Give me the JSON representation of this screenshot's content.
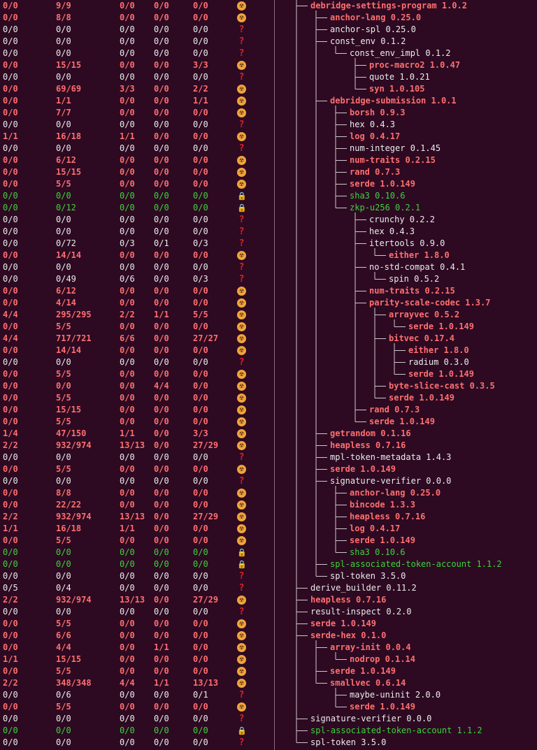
{
  "colors": {
    "background": "#2d0a22",
    "unsafe_red": "#ff6f6f",
    "safe_white": "#ececec",
    "forbid_unsafe_green": "#3bd53b",
    "radioactive_icon": "#f0a53c",
    "unknown_icon": "#e0202a",
    "lock_icon": "#bdbdbd"
  },
  "icons": {
    "radioactive": "radioactive-icon",
    "question": "question-mark-icon",
    "lock": "lock-icon"
  },
  "rows": [
    {
      "cols": [
        "0/0",
        "9/9",
        "0/0",
        "0/0",
        "0/0"
      ],
      "icon": "rad",
      "color": "red",
      "depth": 1,
      "text": "debridge-settings-program 1.0.2"
    },
    {
      "cols": [
        "0/0",
        "8/8",
        "0/0",
        "0/0",
        "0/0"
      ],
      "icon": "rad",
      "color": "red",
      "depth": 2,
      "text": "anchor-lang 0.25.0"
    },
    {
      "cols": [
        "0/0",
        "0/0",
        "0/0",
        "0/0",
        "0/0"
      ],
      "icon": "q",
      "color": "white",
      "depth": 2,
      "text": "anchor-spl 0.25.0"
    },
    {
      "cols": [
        "0/0",
        "0/0",
        "0/0",
        "0/0",
        "0/0"
      ],
      "icon": "q",
      "color": "white",
      "depth": 2,
      "text": "const_env 0.1.2"
    },
    {
      "cols": [
        "0/0",
        "0/0",
        "0/0",
        "0/0",
        "0/0"
      ],
      "icon": "q",
      "color": "white",
      "depth": 3,
      "text": "const_env_impl 0.1.2"
    },
    {
      "cols": [
        "0/0",
        "15/15",
        "0/0",
        "0/0",
        "3/3"
      ],
      "icon": "rad",
      "color": "red",
      "depth": 4,
      "text": "proc-macro2 1.0.47"
    },
    {
      "cols": [
        "0/0",
        "0/0",
        "0/0",
        "0/0",
        "0/0"
      ],
      "icon": "q",
      "color": "white",
      "depth": 4,
      "text": "quote 1.0.21"
    },
    {
      "cols": [
        "0/0",
        "69/69",
        "3/3",
        "0/0",
        "2/2"
      ],
      "icon": "rad",
      "color": "red",
      "depth": 4,
      "text": "syn 1.0.105"
    },
    {
      "cols": [
        "0/0",
        "1/1",
        "0/0",
        "0/0",
        "1/1"
      ],
      "icon": "rad",
      "color": "red",
      "depth": 2,
      "text": "debridge-submission 1.0.1"
    },
    {
      "cols": [
        "0/0",
        "7/7",
        "0/0",
        "0/0",
        "0/0"
      ],
      "icon": "rad",
      "color": "red",
      "depth": 3,
      "text": "borsh 0.9.3"
    },
    {
      "cols": [
        "0/0",
        "0/0",
        "0/0",
        "0/0",
        "0/0"
      ],
      "icon": "q",
      "color": "white",
      "depth": 3,
      "text": "hex 0.4.3"
    },
    {
      "cols": [
        "1/1",
        "16/18",
        "1/1",
        "0/0",
        "0/0"
      ],
      "icon": "rad",
      "color": "red",
      "depth": 3,
      "text": "log 0.4.17"
    },
    {
      "cols": [
        "0/0",
        "0/0",
        "0/0",
        "0/0",
        "0/0"
      ],
      "icon": "q",
      "color": "white",
      "depth": 3,
      "text": "num-integer 0.1.45"
    },
    {
      "cols": [
        "0/0",
        "6/12",
        "0/0",
        "0/0",
        "0/0"
      ],
      "icon": "rad",
      "color": "red",
      "depth": 3,
      "text": "num-traits 0.2.15"
    },
    {
      "cols": [
        "0/0",
        "15/15",
        "0/0",
        "0/0",
        "0/0"
      ],
      "icon": "rad",
      "color": "red",
      "depth": 3,
      "text": "rand 0.7.3"
    },
    {
      "cols": [
        "0/0",
        "5/5",
        "0/0",
        "0/0",
        "0/0"
      ],
      "icon": "rad",
      "color": "red",
      "depth": 3,
      "text": "serde 1.0.149"
    },
    {
      "cols": [
        "0/0",
        "0/0",
        "0/0",
        "0/0",
        "0/0"
      ],
      "icon": "lock",
      "color": "green",
      "depth": 3,
      "text": "sha3 0.10.6"
    },
    {
      "cols": [
        "0/0",
        "0/12",
        "0/0",
        "0/0",
        "0/0"
      ],
      "icon": "lock",
      "color": "green",
      "depth": 3,
      "text": "zkp-u256 0.2.1"
    },
    {
      "cols": [
        "0/0",
        "0/0",
        "0/0",
        "0/0",
        "0/0"
      ],
      "icon": "q",
      "color": "white",
      "depth": 4,
      "text": "crunchy 0.2.2"
    },
    {
      "cols": [
        "0/0",
        "0/0",
        "0/0",
        "0/0",
        "0/0"
      ],
      "icon": "q",
      "color": "white",
      "depth": 4,
      "text": "hex 0.4.3"
    },
    {
      "cols": [
        "0/0",
        "0/72",
        "0/3",
        "0/1",
        "0/3"
      ],
      "icon": "q",
      "color": "white",
      "depth": 4,
      "text": "itertools 0.9.0"
    },
    {
      "cols": [
        "0/0",
        "14/14",
        "0/0",
        "0/0",
        "0/0"
      ],
      "icon": "rad",
      "color": "red",
      "depth": 5,
      "text": "either 1.8.0"
    },
    {
      "cols": [
        "0/0",
        "0/0",
        "0/0",
        "0/0",
        "0/0"
      ],
      "icon": "q",
      "color": "white",
      "depth": 4,
      "text": "no-std-compat 0.4.1"
    },
    {
      "cols": [
        "0/0",
        "0/49",
        "0/6",
        "0/0",
        "0/3"
      ],
      "icon": "q",
      "color": "white",
      "depth": 5,
      "text": "spin 0.5.2"
    },
    {
      "cols": [
        "0/0",
        "6/12",
        "0/0",
        "0/0",
        "0/0"
      ],
      "icon": "rad",
      "color": "red",
      "depth": 4,
      "text": "num-traits 0.2.15"
    },
    {
      "cols": [
        "0/0",
        "4/14",
        "0/0",
        "0/0",
        "0/0"
      ],
      "icon": "rad",
      "color": "red",
      "depth": 4,
      "text": "parity-scale-codec 1.3.7"
    },
    {
      "cols": [
        "4/4",
        "295/295",
        "2/2",
        "1/1",
        "5/5"
      ],
      "icon": "rad",
      "color": "red",
      "depth": 5,
      "text": "arrayvec 0.5.2"
    },
    {
      "cols": [
        "0/0",
        "5/5",
        "0/0",
        "0/0",
        "0/0"
      ],
      "icon": "rad",
      "color": "red",
      "depth": 6,
      "text": "serde 1.0.149"
    },
    {
      "cols": [
        "4/4",
        "717/721",
        "6/6",
        "0/0",
        "27/27"
      ],
      "icon": "rad",
      "color": "red",
      "depth": 5,
      "text": "bitvec 0.17.4"
    },
    {
      "cols": [
        "0/0",
        "14/14",
        "0/0",
        "0/0",
        "0/0"
      ],
      "icon": "rad",
      "color": "red",
      "depth": 6,
      "text": "either 1.8.0"
    },
    {
      "cols": [
        "0/0",
        "0/0",
        "0/0",
        "0/0",
        "0/0"
      ],
      "icon": "q",
      "color": "white",
      "depth": 6,
      "text": "radium 0.3.0"
    },
    {
      "cols": [
        "0/0",
        "5/5",
        "0/0",
        "0/0",
        "0/0"
      ],
      "icon": "rad",
      "color": "red",
      "depth": 6,
      "text": "serde 1.0.149"
    },
    {
      "cols": [
        "0/0",
        "0/0",
        "0/0",
        "4/4",
        "0/0"
      ],
      "icon": "rad",
      "color": "red",
      "depth": 5,
      "text": "byte-slice-cast 0.3.5"
    },
    {
      "cols": [
        "0/0",
        "5/5",
        "0/0",
        "0/0",
        "0/0"
      ],
      "icon": "rad",
      "color": "red",
      "depth": 5,
      "text": "serde 1.0.149"
    },
    {
      "cols": [
        "0/0",
        "15/15",
        "0/0",
        "0/0",
        "0/0"
      ],
      "icon": "rad",
      "color": "red",
      "depth": 4,
      "text": "rand 0.7.3"
    },
    {
      "cols": [
        "0/0",
        "5/5",
        "0/0",
        "0/0",
        "0/0"
      ],
      "icon": "rad",
      "color": "red",
      "depth": 4,
      "text": "serde 1.0.149"
    },
    {
      "cols": [
        "1/4",
        "47/150",
        "1/1",
        "0/0",
        "3/3"
      ],
      "icon": "rad",
      "color": "red",
      "depth": 2,
      "text": "getrandom 0.1.16"
    },
    {
      "cols": [
        "2/2",
        "932/974",
        "13/13",
        "0/0",
        "27/29"
      ],
      "icon": "rad",
      "color": "red",
      "depth": 2,
      "text": "heapless 0.7.16"
    },
    {
      "cols": [
        "0/0",
        "0/0",
        "0/0",
        "0/0",
        "0/0"
      ],
      "icon": "q",
      "color": "white",
      "depth": 2,
      "text": "mpl-token-metadata 1.4.3"
    },
    {
      "cols": [
        "0/0",
        "5/5",
        "0/0",
        "0/0",
        "0/0"
      ],
      "icon": "rad",
      "color": "red",
      "depth": 2,
      "text": "serde 1.0.149"
    },
    {
      "cols": [
        "0/0",
        "0/0",
        "0/0",
        "0/0",
        "0/0"
      ],
      "icon": "q",
      "color": "white",
      "depth": 2,
      "text": "signature-verifier 0.0.0"
    },
    {
      "cols": [
        "0/0",
        "8/8",
        "0/0",
        "0/0",
        "0/0"
      ],
      "icon": "rad",
      "color": "red",
      "depth": 3,
      "text": "anchor-lang 0.25.0"
    },
    {
      "cols": [
        "0/0",
        "22/22",
        "0/0",
        "0/0",
        "0/0"
      ],
      "icon": "rad",
      "color": "red",
      "depth": 3,
      "text": "bincode 1.3.3"
    },
    {
      "cols": [
        "2/2",
        "932/974",
        "13/13",
        "0/0",
        "27/29"
      ],
      "icon": "rad",
      "color": "red",
      "depth": 3,
      "text": "heapless 0.7.16"
    },
    {
      "cols": [
        "1/1",
        "16/18",
        "1/1",
        "0/0",
        "0/0"
      ],
      "icon": "rad",
      "color": "red",
      "depth": 3,
      "text": "log 0.4.17"
    },
    {
      "cols": [
        "0/0",
        "5/5",
        "0/0",
        "0/0",
        "0/0"
      ],
      "icon": "rad",
      "color": "red",
      "depth": 3,
      "text": "serde 1.0.149"
    },
    {
      "cols": [
        "0/0",
        "0/0",
        "0/0",
        "0/0",
        "0/0"
      ],
      "icon": "lock",
      "color": "green",
      "depth": 3,
      "text": "sha3 0.10.6"
    },
    {
      "cols": [
        "0/0",
        "0/0",
        "0/0",
        "0/0",
        "0/0"
      ],
      "icon": "lock",
      "color": "green",
      "depth": 2,
      "text": "spl-associated-token-account 1.1.2"
    },
    {
      "cols": [
        "0/0",
        "0/0",
        "0/0",
        "0/0",
        "0/0"
      ],
      "icon": "q",
      "color": "white",
      "depth": 2,
      "text": "spl-token 3.5.0"
    },
    {
      "cols": [
        "0/5",
        "0/4",
        "0/0",
        "0/0",
        "0/0"
      ],
      "icon": "q",
      "color": "white",
      "depth": 1,
      "text": "derive_builder 0.11.2"
    },
    {
      "cols": [
        "2/2",
        "932/974",
        "13/13",
        "0/0",
        "27/29"
      ],
      "icon": "rad",
      "color": "red",
      "depth": 1,
      "text": "heapless 0.7.16"
    },
    {
      "cols": [
        "0/0",
        "0/0",
        "0/0",
        "0/0",
        "0/0"
      ],
      "icon": "q",
      "color": "white",
      "depth": 1,
      "text": "result-inspect 0.2.0"
    },
    {
      "cols": [
        "0/0",
        "5/5",
        "0/0",
        "0/0",
        "0/0"
      ],
      "icon": "rad",
      "color": "red",
      "depth": 1,
      "text": "serde 1.0.149"
    },
    {
      "cols": [
        "0/0",
        "6/6",
        "0/0",
        "0/0",
        "0/0"
      ],
      "icon": "rad",
      "color": "red",
      "depth": 1,
      "text": "serde-hex 0.1.0"
    },
    {
      "cols": [
        "0/0",
        "4/4",
        "0/0",
        "1/1",
        "0/0"
      ],
      "icon": "rad",
      "color": "red",
      "depth": 2,
      "text": "array-init 0.0.4"
    },
    {
      "cols": [
        "1/1",
        "15/15",
        "0/0",
        "0/0",
        "0/0"
      ],
      "icon": "rad",
      "color": "red",
      "depth": 3,
      "text": "nodrop 0.1.14"
    },
    {
      "cols": [
        "0/0",
        "5/5",
        "0/0",
        "0/0",
        "0/0"
      ],
      "icon": "rad",
      "color": "red",
      "depth": 2,
      "text": "serde 1.0.149"
    },
    {
      "cols": [
        "2/2",
        "348/348",
        "4/4",
        "1/1",
        "13/13"
      ],
      "icon": "rad",
      "color": "red",
      "depth": 2,
      "text": "smallvec 0.6.14"
    },
    {
      "cols": [
        "0/0",
        "0/6",
        "0/0",
        "0/0",
        "0/1"
      ],
      "icon": "q",
      "color": "white",
      "depth": 3,
      "text": "maybe-uninit 2.0.0"
    },
    {
      "cols": [
        "0/0",
        "5/5",
        "0/0",
        "0/0",
        "0/0"
      ],
      "icon": "rad",
      "color": "red",
      "depth": 3,
      "text": "serde 1.0.149"
    },
    {
      "cols": [
        "0/0",
        "0/0",
        "0/0",
        "0/0",
        "0/0"
      ],
      "icon": "q",
      "color": "white",
      "depth": 1,
      "text": "signature-verifier 0.0.0"
    },
    {
      "cols": [
        "0/0",
        "0/0",
        "0/0",
        "0/0",
        "0/0"
      ],
      "icon": "lock",
      "color": "green",
      "depth": 1,
      "text": "spl-associated-token-account 1.1.2"
    },
    {
      "cols": [
        "0/0",
        "0/0",
        "0/0",
        "0/0",
        "0/0"
      ],
      "icon": "q",
      "color": "white",
      "depth": 1,
      "text": "spl-token 3.5.0"
    }
  ]
}
